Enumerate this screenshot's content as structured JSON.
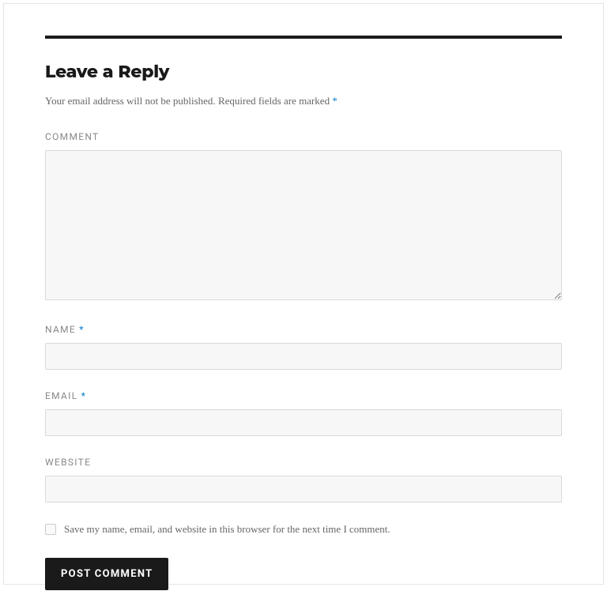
{
  "heading": "Leave a Reply",
  "privacy_note_prefix": "Your email address will not be published.",
  "privacy_note_required": "Required fields are marked",
  "asterisk": "*",
  "fields": {
    "comment": {
      "label": "COMMENT",
      "value": ""
    },
    "name": {
      "label": "NAME",
      "value": ""
    },
    "email": {
      "label": "EMAIL",
      "value": ""
    },
    "website": {
      "label": "WEBSITE",
      "value": ""
    }
  },
  "consent": {
    "label": "Save my name, email, and website in this browser for the next time I comment.",
    "checked": false
  },
  "submit_label": "POST COMMENT"
}
